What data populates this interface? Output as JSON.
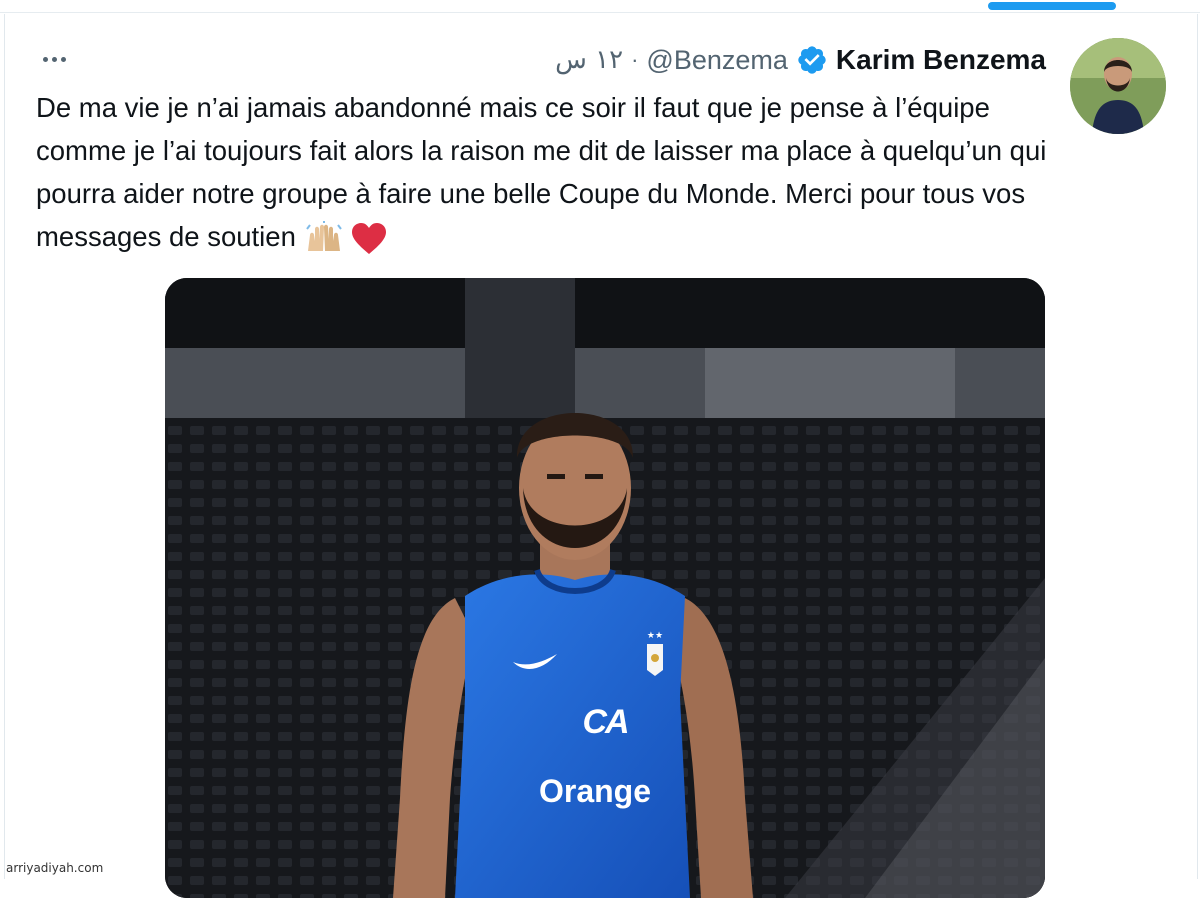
{
  "tweet": {
    "author_name": "Karim Benzema",
    "author_handle": "@Benzema",
    "separator": "·",
    "time_ago": "١٢ س",
    "text": "De ma vie je n’ai jamais abandonné mais ce soir il faut que je pense à l’équipe comme je l’ai toujours fait alors la raison me dit de laisser ma place à quelqu’un qui pourra aider notre groupe à faire une belle Coupe du Monde. Merci pour tous vos messages de soutien",
    "emojis": [
      "raising-hands",
      "red-heart"
    ],
    "media": {
      "jersey_brand": "CA",
      "jersey_sponsor": "Orange"
    }
  },
  "watermark": "arriyadiyah.com",
  "colors": {
    "accent": "#1d9bf0",
    "text_primary": "#0f1419",
    "text_secondary": "#536471",
    "jersey_blue": "#1f66d6",
    "heart_red": "#e0245e"
  }
}
